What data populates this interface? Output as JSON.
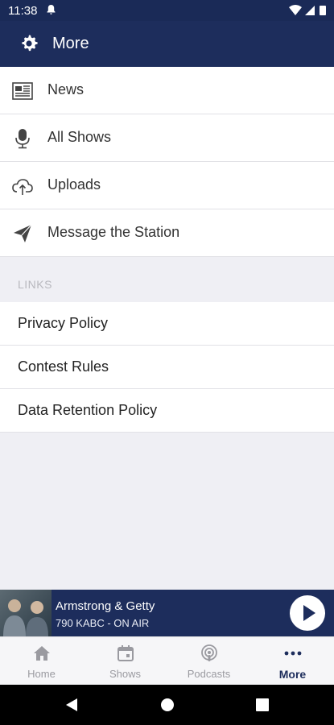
{
  "status_bar": {
    "time": "11:38",
    "icons": [
      "bell-icon",
      "wifi-icon",
      "cellular-icon",
      "battery-icon"
    ]
  },
  "app_bar": {
    "title": "More",
    "icon": "gear-icon"
  },
  "menu": [
    {
      "label": "News",
      "icon": "newspaper-icon"
    },
    {
      "label": "All Shows",
      "icon": "microphone-icon"
    },
    {
      "label": "Uploads",
      "icon": "cloud-upload-icon"
    },
    {
      "label": "Message the Station",
      "icon": "paper-plane-icon"
    }
  ],
  "links": {
    "header": "LINKS",
    "items": [
      "Privacy Policy",
      "Contest Rules",
      "Data Retention Policy"
    ]
  },
  "player": {
    "show": "Armstrong & Getty",
    "station": "790 KABC - ON AIR",
    "icon": "play-icon"
  },
  "tabs": [
    {
      "label": "Home",
      "icon": "home-icon",
      "active": false
    },
    {
      "label": "Shows",
      "icon": "calendar-icon",
      "active": false
    },
    {
      "label": "Podcasts",
      "icon": "podcast-icon",
      "active": false
    },
    {
      "label": "More",
      "icon": "more-dots-icon",
      "active": true
    }
  ],
  "colors": {
    "primary": "#1d2d5c",
    "background": "#efeff4",
    "inactive_tab": "#9a9aa0"
  }
}
